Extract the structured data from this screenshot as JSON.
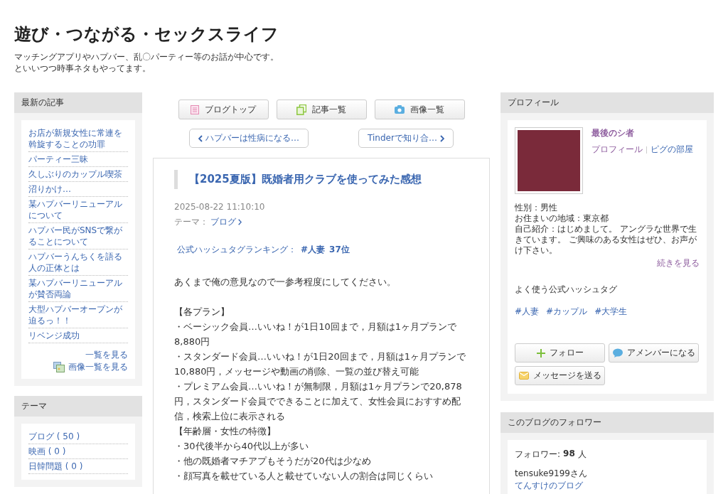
{
  "blog": {
    "title": "遊び・つながる・セックスライフ",
    "description": [
      "マッチングアプリやハプバー、乱〇パーティー等のお話が中心です。",
      "といいつつ時事ネタもやってます。"
    ]
  },
  "recent": {
    "header": "最新の記事",
    "items": [
      "お店が新規女性に常連を斡旋することの功罪",
      "パーティー三昧",
      "久しぶりのカップル喫茶",
      "沼りかけ…",
      "某ハプバーリニューアルについて",
      "ハプバー民がSNSで繋がることについて",
      "ハプバーうんちくを語る人の正体とは",
      "某ハプバーリニューアルが賛否両論",
      "大型ハプバーオープンが迫るっ！！",
      "リベンジ成功"
    ],
    "more_link": "一覧を見る",
    "image_link": "画像一覧を見る"
  },
  "themes": {
    "header": "テーマ",
    "items": [
      "ブログ ( 50 )",
      "映画 ( 0 )",
      "日韓問題 ( 0 )"
    ]
  },
  "nav_buttons": [
    {
      "label": "ブログトップ",
      "kind": "page"
    },
    {
      "label": "記事一覧",
      "kind": "docs"
    },
    {
      "label": "画像一覧",
      "kind": "camera"
    }
  ],
  "pager": {
    "prev": "ハプバーは性病になる…",
    "next": "Tinderで知り合…"
  },
  "article": {
    "title": "【2025夏版】既婚者用クラブを使ってみた感想",
    "date": "2025-08-22 11:10:10",
    "theme_label": "テーマ：",
    "theme": "ブログ",
    "ranking_label": "公式ハッシュタグランキング：",
    "ranking_tag": "#人妻",
    "ranking_rank": "37位",
    "intro": "あくまで俺の意見なので一参考程度にしてください。",
    "body": [
      "【各プラン】",
      "・ベーシック会員…いいね！が1日10回まで，月額は1ヶ月プランで8,880円",
      "・スタンダード会員…いいね！が1日20回まで，月額は1ヶ月プランで10,880円，メッセージや動画の削除、一覧の並び替え可能",
      "・プレミアム会員…いいね！が無制限，月額は1ヶ月プランで20,878円，スタンダード会員でできることに加えて、女性会員におすすめ配信，検索上位に表示される",
      "【年齢層・女性の特徴】",
      "・30代後半から40代以上が多い",
      "・他の既婚者マチアプもそうだが20代は少なめ",
      "・顔写真を載せている人と載せていない人の割合は同じくらい"
    ]
  },
  "profile": {
    "header": "プロフィール",
    "name": "最後のシ者",
    "links": [
      "プロフィール",
      "ピグの部屋"
    ],
    "details": [
      "性別：男性",
      "お住まいの地域：東京都",
      "自己紹介：はじめまして。 アングラな世界で生きています。 ご興味のある女性はぜひ、お声がけ下さい。"
    ],
    "read_more": "続きを見る",
    "hashtag_header": "よく使う公式ハッシュタグ",
    "hashtags": [
      "#人妻",
      "#カップル",
      "#大学生"
    ],
    "buttons": [
      {
        "label": "フォロー",
        "kind": "follow"
      },
      {
        "label": "アメンバーになる",
        "kind": "amember"
      },
      {
        "label": "メッセージを送る",
        "kind": "message"
      }
    ]
  },
  "followers": {
    "header": "このブログのフォロワー",
    "count_label": "フォロワー:",
    "count": "98",
    "unit": "人",
    "follower_name": "tensuke9199さん",
    "follower_blog": "てんすけのブログ"
  }
}
